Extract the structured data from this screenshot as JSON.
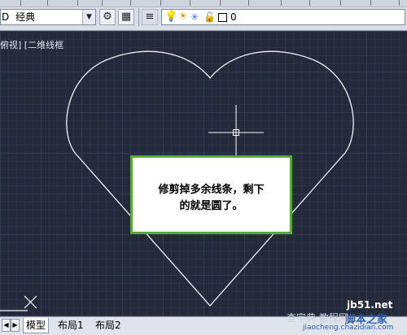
{
  "toolbar": {
    "workspace_value": "经典",
    "workspace_prefix": "D",
    "layer_value": "0"
  },
  "viewport": {
    "label": "俯视] [二维线框"
  },
  "callout": {
    "line1": "修剪掉多余线条，剩下",
    "line2": "的就是圆了。"
  },
  "tabs": [
    "模型",
    "布局1",
    "布局2"
  ],
  "watermark": {
    "site": "jb51.net",
    "title": "脚本之家",
    "sub": "查字典 教程网",
    "url": "jiaocheng.chazidian.com"
  },
  "colors": {
    "canvas": "#242a3a",
    "callout_border": "#5aa83a",
    "geometry": "#f2f2f2"
  }
}
